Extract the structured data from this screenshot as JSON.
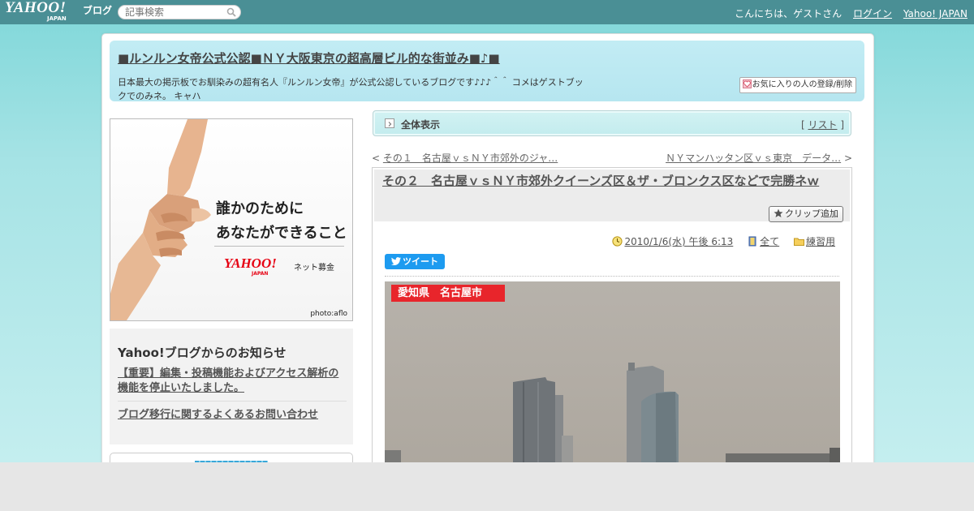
{
  "topbar": {
    "logo_main": "YAHOO!",
    "logo_sub": "JAPAN",
    "logo_blog": "ブログ",
    "search_placeholder": "記事検索",
    "greeting": "こんにちは、ゲストさん",
    "login": "ログイン",
    "yahoo_japan": "Yahoo! JAPAN"
  },
  "blog": {
    "title": "■ルンルン女帝公式公認■ＮＹ大阪東京の超高層ビル的な街並み■♪■",
    "description": "日本最大の掲示板でお馴染みの超有名人『ルンルン女帝』が公式公認しているブログです♪♪♪＾＾ コメはゲストブックでのみネ。 キャハ",
    "fav_button": "お気に入りの人の登録/削除"
  },
  "banner": {
    "line1": "誰かのために",
    "line2": "あなたができること",
    "logo": "YAHOO!",
    "logo_sub": "JAPAN",
    "net": "ネット募金",
    "credit": "photo:aflo"
  },
  "notice": {
    "title": "Yahoo!ブログからのお知らせ",
    "link1": "【重要】編集・投稿機能およびアクセス解析の機能を停止いたしました。",
    "link2": "ブログ移行に関するよくあるお問い合わせ"
  },
  "viewall": {
    "label": "全体表示",
    "list_open": "[ ",
    "list_label": "リスト",
    "list_close": " ]"
  },
  "nav": {
    "prev_arrow": "< ",
    "prev_label": "その１　名古屋ｖｓＮＹ市郊外のジャ…",
    "next_label": "ＮＹマンハッタン区ｖｓ東京　データ…",
    "next_arrow": " >"
  },
  "article": {
    "title": "その２　名古屋ｖｓＮＹ市郊外クイーンズ区＆ザ・ブロンクス区などで完勝ネｗ",
    "clip": "クリップ追加",
    "date": "2010/1/6(水) 午後 6:13",
    "visibility": "全て",
    "category": "練習用",
    "tweet": "ツイート",
    "photo_label": "愛知県　名古屋市"
  },
  "colors": {
    "topbar": "#4a8f95",
    "header": "#c2ecf4",
    "twitter": "#1d9bf0",
    "label_red": "#e8252b"
  }
}
